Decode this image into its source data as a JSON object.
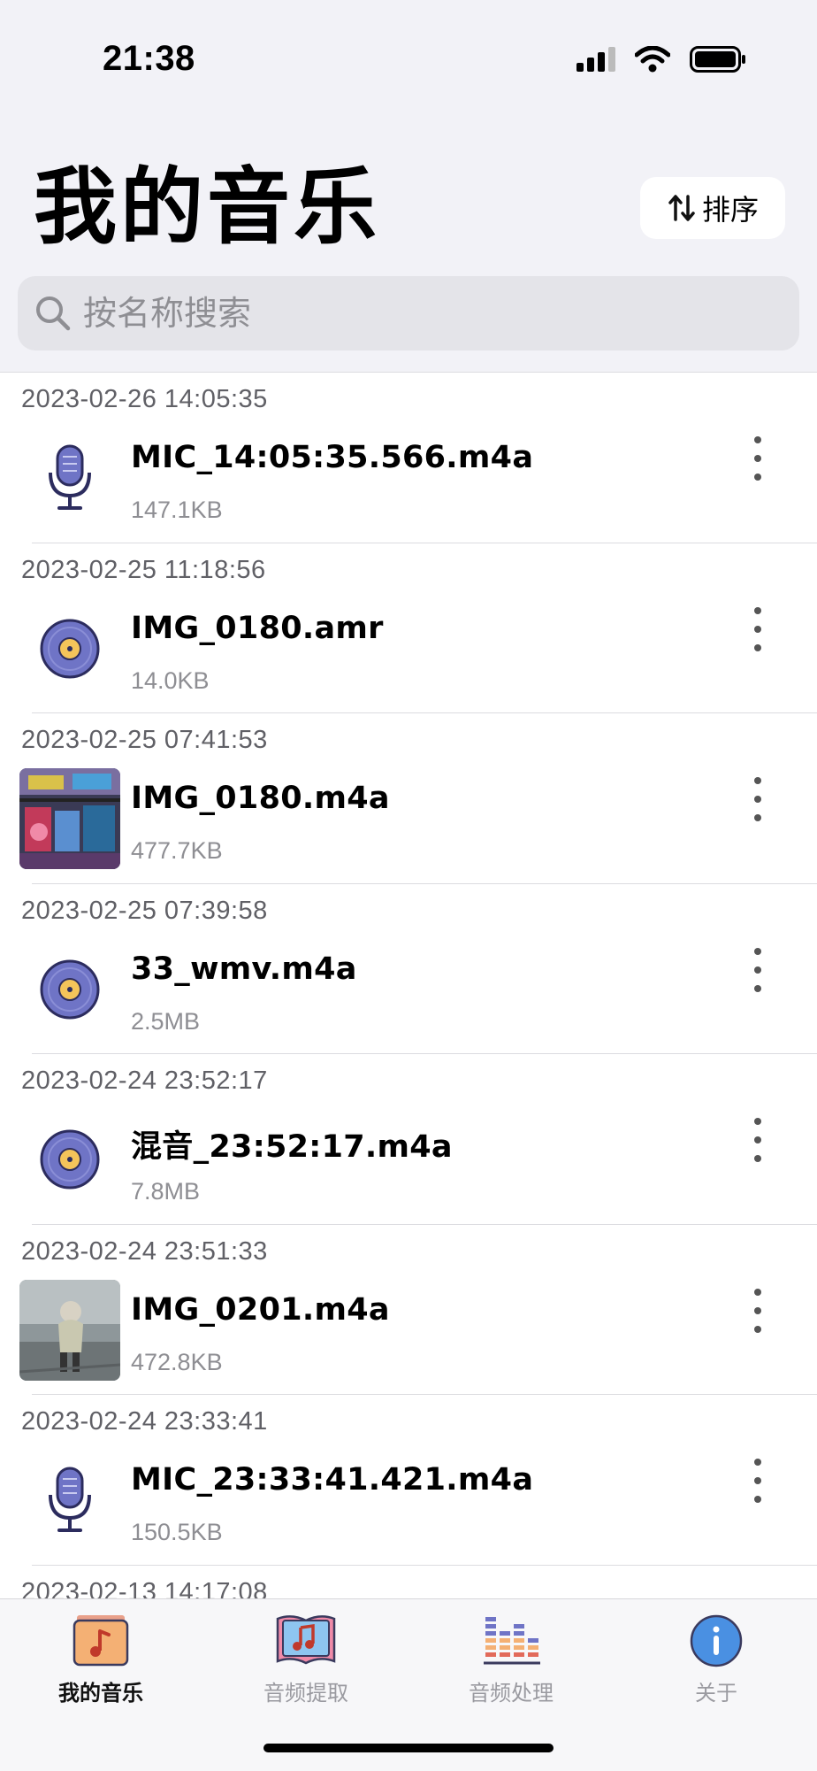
{
  "status_bar": {
    "time": "21:38"
  },
  "header": {
    "title": "我的音乐",
    "sort_label": "排序"
  },
  "search": {
    "placeholder": "按名称搜索"
  },
  "items": [
    {
      "date": "2023-02-26 14:05:35",
      "name": "MIC_14:05:35.566.m4a",
      "size": "147.1KB",
      "icon": "microphone-icon"
    },
    {
      "date": "2023-02-25 11:18:56",
      "name": "IMG_0180.amr",
      "size": "14.0KB",
      "icon": "vinyl-disc-icon"
    },
    {
      "date": "2023-02-25 07:41:53",
      "name": "IMG_0180.m4a",
      "size": "477.7KB",
      "icon": "video-thumbnail"
    },
    {
      "date": "2023-02-25 07:39:58",
      "name": "33_wmv.m4a",
      "size": "2.5MB",
      "icon": "vinyl-disc-icon"
    },
    {
      "date": "2023-02-24 23:52:17",
      "name": "混音_23:52:17.m4a",
      "size": "7.8MB",
      "icon": "vinyl-disc-icon"
    },
    {
      "date": "2023-02-24 23:51:33",
      "name": "IMG_0201.m4a",
      "size": "472.8KB",
      "icon": "video-thumbnail"
    },
    {
      "date": "2023-02-24 23:33:41",
      "name": "MIC_23:33:41.421.m4a",
      "size": "150.5KB",
      "icon": "microphone-icon"
    },
    {
      "date": "2023-02-13 14:17:08",
      "name": "",
      "size": "",
      "icon": ""
    }
  ],
  "tabs": [
    {
      "label": "我的音乐",
      "icon": "music-folder-icon",
      "active": true
    },
    {
      "label": "音频提取",
      "icon": "music-book-icon",
      "active": false
    },
    {
      "label": "音频处理",
      "icon": "equalizer-icon",
      "active": false
    },
    {
      "label": "关于",
      "icon": "info-icon",
      "active": false
    }
  ],
  "colors": {
    "accent": "#6f74c6",
    "background": "#f2f2f7",
    "info_blue": "#4a90e2"
  }
}
